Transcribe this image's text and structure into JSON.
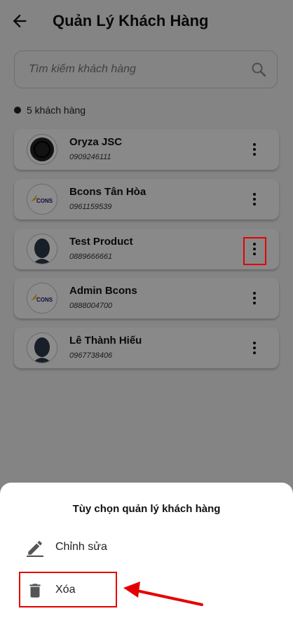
{
  "header": {
    "title": "Quản Lý Khách Hàng"
  },
  "search": {
    "placeholder": "Tìm kiếm khách hàng"
  },
  "list": {
    "count_label": "5 khách hàng",
    "customers": [
      {
        "name": "Oryza JSC",
        "phone": "0909246111",
        "avatar": "ring-logo"
      },
      {
        "name": "Bcons Tân Hòa",
        "phone": "0961159539",
        "avatar": "bcons-logo",
        "logo_text": "CONS"
      },
      {
        "name": "Test Product",
        "phone": "0889666661",
        "avatar": "person-silhouette"
      },
      {
        "name": "Admin Bcons",
        "phone": "0888004700",
        "avatar": "bcons-logo",
        "logo_text": "CONS"
      },
      {
        "name": "Lê Thành Hiếu",
        "phone": "0967738406",
        "avatar": "person-silhouette"
      }
    ]
  },
  "sheet": {
    "title": "Tùy chọn quản lý khách hàng",
    "options": [
      {
        "label": "Chỉnh sửa",
        "icon": "pencil-icon"
      },
      {
        "label": "Xóa",
        "icon": "trash-icon"
      }
    ]
  },
  "colors": {
    "highlight": "#e50000",
    "overlay": "rgba(0,0,0,0.45)"
  }
}
